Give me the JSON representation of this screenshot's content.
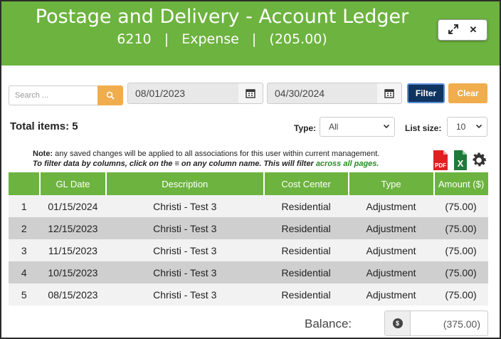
{
  "header": {
    "title": "Postage and Delivery - Account Ledger",
    "account_number": "6210",
    "account_type": "Expense",
    "account_total": "(205.00)",
    "expand_icon": "expand-icon",
    "close_icon": "close-icon"
  },
  "filters": {
    "search_placeholder": "Search ...",
    "start_date": "08/01/2023",
    "end_date": "04/30/2024",
    "filter_label": "Filter",
    "clear_label": "Clear"
  },
  "summary": {
    "total_items": "Total items: 5",
    "type_label": "Type:",
    "type_value": "All",
    "list_size_label": "List size:",
    "list_size_value": "10"
  },
  "note": {
    "prefix": "Note:",
    "text": " any saved changes will be applied to all associations for this user within current management.",
    "filter_hint": "To filter data by columns, click on the ≡ on any column name. This will filter ",
    "filter_hint_accent": "across all pages."
  },
  "tools": {
    "pdf_label": "PDF",
    "excel_label": "X"
  },
  "table": {
    "columns": [
      "",
      "GL Date",
      "Description",
      "Cost Center",
      "Type",
      "Amount ($)"
    ],
    "rows": [
      [
        "1",
        "01/15/2024",
        "Christi - Test 3",
        "Residential",
        "Adjustment",
        "(75.00)"
      ],
      [
        "2",
        "12/15/2023",
        "Christi - Test 3",
        "Residential",
        "Adjustment",
        "(75.00)"
      ],
      [
        "3",
        "11/15/2023",
        "Christi - Test 3",
        "Residential",
        "Adjustment",
        "(75.00)"
      ],
      [
        "4",
        "10/15/2023",
        "Christi - Test 3",
        "Residential",
        "Adjustment",
        "(75.00)"
      ],
      [
        "5",
        "08/15/2023",
        "Christi - Test 3",
        "Residential",
        "Adjustment",
        "(75.00)"
      ]
    ]
  },
  "balance": {
    "label": "Balance:",
    "currency_symbol": "$",
    "value": "(375.00)"
  },
  "colors": {
    "brand_green": "#6db33f",
    "filter_navy": "#0f3460",
    "accent_orange": "#f0ad4e"
  }
}
